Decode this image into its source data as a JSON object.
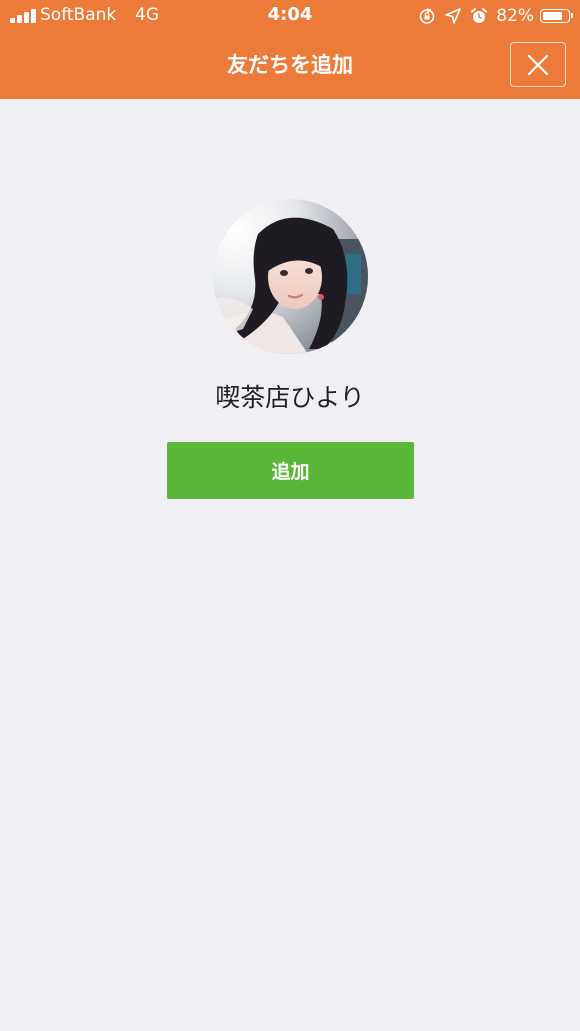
{
  "status_bar": {
    "carrier": "SoftBank",
    "network": "4G",
    "time": "4:04",
    "battery_percent": "82%",
    "battery_level": 0.82,
    "icons": [
      "signal-bars-icon",
      "orientation-lock-icon",
      "location-arrow-icon",
      "alarm-icon",
      "battery-icon"
    ]
  },
  "header": {
    "title": "友だちを追加",
    "close_icon": "close-icon",
    "background_color": "#ec7b3a"
  },
  "profile": {
    "name": "喫茶店ひより",
    "avatar_icon": "profile-photo"
  },
  "actions": {
    "add_label": "追加",
    "add_color": "#5ab639"
  },
  "page": {
    "background_color": "#efeff4"
  }
}
